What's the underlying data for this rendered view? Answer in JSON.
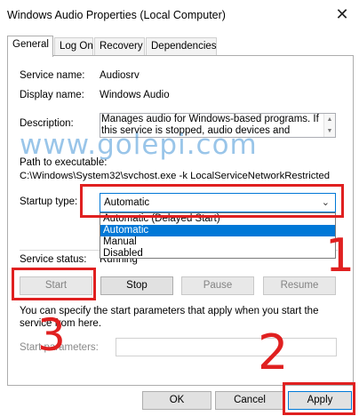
{
  "window": {
    "title": "Windows Audio Properties (Local Computer)",
    "close_glyph": "✕"
  },
  "tabs": [
    {
      "label": "General"
    },
    {
      "label": "Log On"
    },
    {
      "label": "Recovery"
    },
    {
      "label": "Dependencies"
    }
  ],
  "general": {
    "service_name_label": "Service name:",
    "service_name_value": "Audiosrv",
    "display_name_label": "Display name:",
    "display_name_value": "Windows Audio",
    "description_label": "Description:",
    "description_text": "Manages audio for Windows-based programs.  If this service is stopped, audio devices and effects will not",
    "path_label": "Path to executable:",
    "path_value": "C:\\Windows\\System32\\svchost.exe -k LocalServiceNetworkRestricted",
    "startup_type_label": "Startup type:",
    "startup_type_value": "Automatic",
    "startup_options": [
      "Automatic (Delayed Start)",
      "Automatic",
      "Manual",
      "Disabled"
    ],
    "startup_selected_index": 1,
    "service_status_label": "Service status:",
    "service_status_value": "Running",
    "buttons": {
      "start": "Start",
      "stop": "Stop",
      "pause": "Pause",
      "resume": "Resume"
    },
    "start_params_hint": "You can specify the start parameters that apply when you start the service from here.",
    "start_params_label": "Start parameters:",
    "start_params_value": ""
  },
  "footer": {
    "ok": "OK",
    "cancel": "Cancel",
    "apply": "Apply"
  },
  "overlay": {
    "watermark": "www.golepi.com",
    "annotation_1": "1",
    "annotation_2": "2",
    "annotation_3": "3",
    "annotation_color": "#e02020",
    "watermark_color": "#4696d7"
  },
  "colors": {
    "accent": "#0078d7",
    "selection": "#0078d7"
  }
}
